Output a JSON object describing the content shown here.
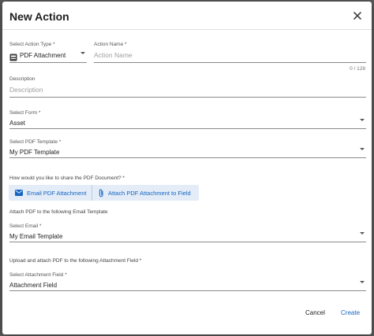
{
  "dialog": {
    "title": "New Action",
    "close_icon": "close-icon"
  },
  "action_type": {
    "label": "Select Action Type *",
    "value": "PDF Attachment",
    "icon": "pdf-icon"
  },
  "action_name": {
    "label": "Action Name *",
    "placeholder": "Action Name",
    "counter": "0 / 128"
  },
  "description": {
    "label": "Description",
    "placeholder": "Description"
  },
  "select_form": {
    "label": "Select Form *",
    "value": "Asset"
  },
  "pdf_template": {
    "label": "Select PDF Template *",
    "value": "My PDF Template"
  },
  "share": {
    "question": "How would you like to share the PDF Document? *",
    "option_email": "Email PDF Attachment",
    "option_field": "Attach PDF Attachment to Field",
    "email_icon": "mail-icon",
    "field_icon": "paperclip-icon"
  },
  "email_section": {
    "heading": "Attach PDF to the following Email Template",
    "label": "Select Email *",
    "value": "My Email Template"
  },
  "attachment_section": {
    "heading": "Upload and attach PDF to the following Attachment Field *",
    "label": "Select Attachment Field *",
    "value": "Attachment Field"
  },
  "footer": {
    "cancel_label": "Cancel",
    "create_label": "Create"
  },
  "colors": {
    "accent": "#1565c0",
    "toggle_bg": "#e3ecf7",
    "backdrop": "#5a5a5a"
  }
}
